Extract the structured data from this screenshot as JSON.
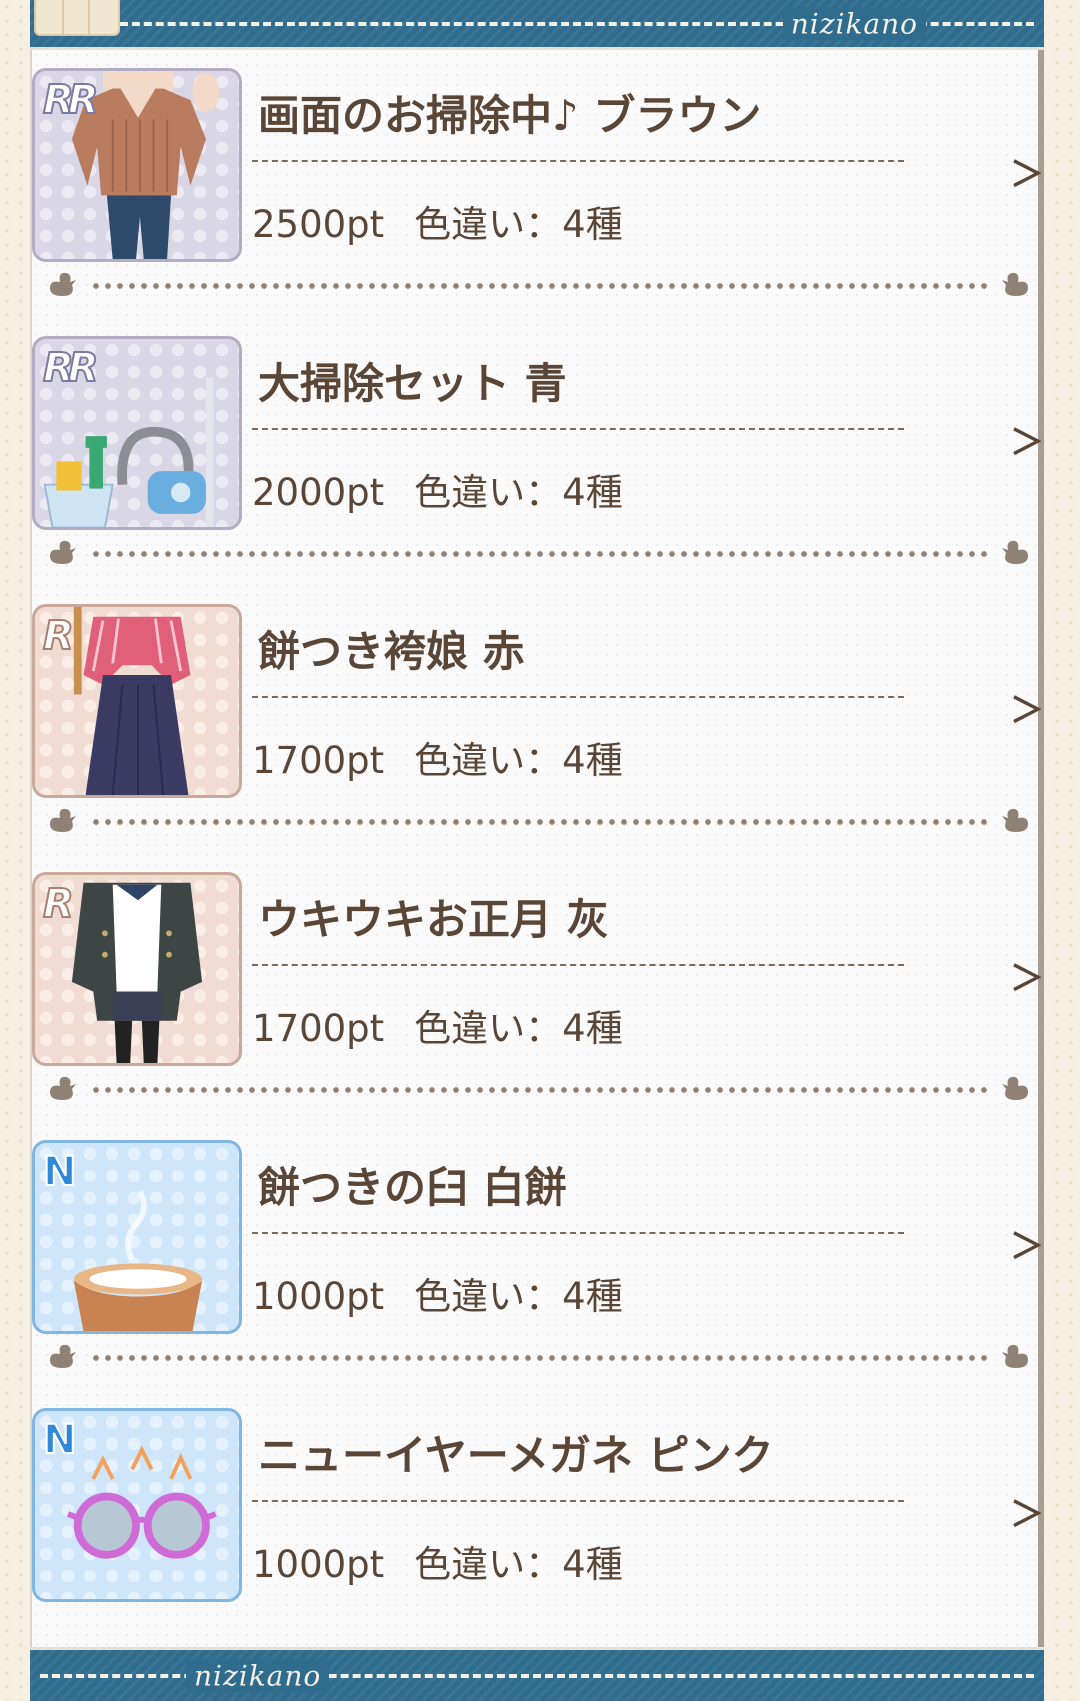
{
  "brand": "nizikano",
  "colors": {
    "banner": "#2f6c8e",
    "text": "#5a4637",
    "rarity_rr": "#d9d7e6",
    "rarity_r": "#f0dcd3",
    "rarity_n": "#cfe6fa"
  },
  "items": [
    {
      "rarity": "RR",
      "title": "画面のお掃除中♪ ブラウン",
      "points": "2500pt",
      "variants": "色違い：4種",
      "arrow": "＞",
      "icon": "sweater-outfit-icon"
    },
    {
      "rarity": "RR",
      "title": "大掃除セット 青",
      "points": "2000pt",
      "variants": "色違い：4種",
      "arrow": "＞",
      "icon": "cleaning-set-icon"
    },
    {
      "rarity": "R",
      "title": "餅つき袴娘 赤",
      "points": "1700pt",
      "variants": "色違い：4種",
      "arrow": "＞",
      "icon": "hakama-outfit-icon"
    },
    {
      "rarity": "R",
      "title": "ウキウキお正月 灰",
      "points": "1700pt",
      "variants": "色違い：4種",
      "arrow": "＞",
      "icon": "coat-outfit-icon"
    },
    {
      "rarity": "N",
      "title": "餅つきの臼 白餅",
      "points": "1000pt",
      "variants": "色違い：4種",
      "arrow": "＞",
      "icon": "mochi-mortar-icon"
    },
    {
      "rarity": "N",
      "title": "ニューイヤーメガネ ピンク",
      "points": "1000pt",
      "variants": "色違い：4種",
      "arrow": "＞",
      "icon": "new-year-glasses-icon"
    }
  ]
}
